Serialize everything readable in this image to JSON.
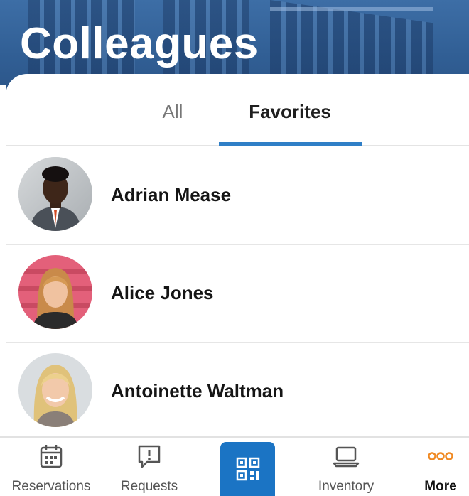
{
  "header": {
    "title": "Colleagues"
  },
  "tabs": [
    {
      "label": "All",
      "selected": false
    },
    {
      "label": "Favorites",
      "selected": true
    }
  ],
  "colleagues": [
    {
      "name": "Adrian Mease",
      "avatar": "male-portrait"
    },
    {
      "name": "Alice Jones",
      "avatar": "female-portrait-red-hair"
    },
    {
      "name": "Antoinette Waltman",
      "avatar": "female-portrait-blonde"
    }
  ],
  "bottom_nav": {
    "items": [
      {
        "label": "Reservations",
        "icon": "calendar-icon"
      },
      {
        "label": "Requests",
        "icon": "chat-alert-icon"
      },
      {
        "label": "",
        "icon": "qr-scan-icon"
      },
      {
        "label": "Inventory",
        "icon": "laptop-icon"
      },
      {
        "label": "More",
        "icon": "more-dots-icon",
        "active": true
      }
    ]
  },
  "colors": {
    "accent": "#2f7fc7",
    "scan_button": "#1b74c4",
    "more_icon": "#f08a24",
    "header_bg": "#315f95"
  }
}
